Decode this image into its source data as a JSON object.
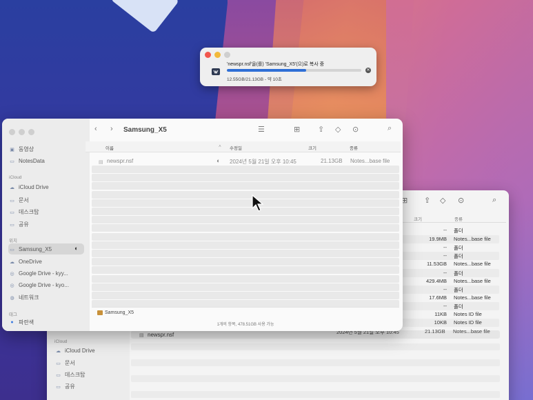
{
  "copy_dialog": {
    "title": "'newspr.nsf'을(를) 'Samsung_X5'(으)로 복사 중",
    "status": "12.55GB/21.13GB - 약 10초",
    "progress": 0.59
  },
  "front_window": {
    "title": "Samsung_X5",
    "sidebar": {
      "items_top": [
        "동영상",
        "NotesData"
      ],
      "icloud_header": "iCloud",
      "icloud_items": [
        "iCloud Drive",
        "문서",
        "데스크탑",
        "공유"
      ],
      "locations_header": "위치",
      "location_items": [
        "Samsung_X5",
        "OneDrive",
        "Google Drive - kyy...",
        "Google Drive - kyo...",
        "네트워크"
      ],
      "tags_header": "태그",
      "tag_items": [
        "파란색"
      ]
    },
    "columns": {
      "name": "이름",
      "modified": "수정일",
      "size": "크기",
      "kind": "종류"
    },
    "file": {
      "name": "newspr.nsf",
      "modified": "2024년 5월 21일 오후 10:45",
      "size": "21.13GB",
      "kind": "Notes...base file"
    },
    "path_label": "Samsung_X5",
    "status_text": "1개의 항목, 478.51GB 사용 가능"
  },
  "back_window": {
    "sidebar": {
      "icloud_header": "iCloud",
      "icloud_items": [
        "iCloud Drive",
        "문서",
        "데스크탑",
        "공유"
      ]
    },
    "columns": {
      "size": "크기",
      "kind": "종류"
    },
    "rows": [
      {
        "size": "--",
        "kind": "폴더"
      },
      {
        "size": "19.9MB",
        "kind": "Notes...base file"
      },
      {
        "size": "--",
        "kind": "폴더"
      },
      {
        "size": "--",
        "kind": "폴더"
      },
      {
        "size": "11.53GB",
        "kind": "Notes...base file"
      },
      {
        "size": "--",
        "kind": "폴더"
      },
      {
        "size": "429.4MB",
        "kind": "Notes...base file"
      },
      {
        "size": "--",
        "kind": "폴더"
      },
      {
        "size": "17.6MB",
        "kind": "Notes...base file"
      },
      {
        "size": "--",
        "kind": "폴더"
      },
      {
        "size": "11KB",
        "kind": "Notes ID file"
      },
      {
        "size": "10KB",
        "kind": "Notes ID file"
      }
    ],
    "selected_file": {
      "name": "newspr.nsf",
      "modified": "2024년 5월 21일 오후 10:45",
      "size": "21.13GB",
      "kind": "Notes...base file"
    }
  }
}
